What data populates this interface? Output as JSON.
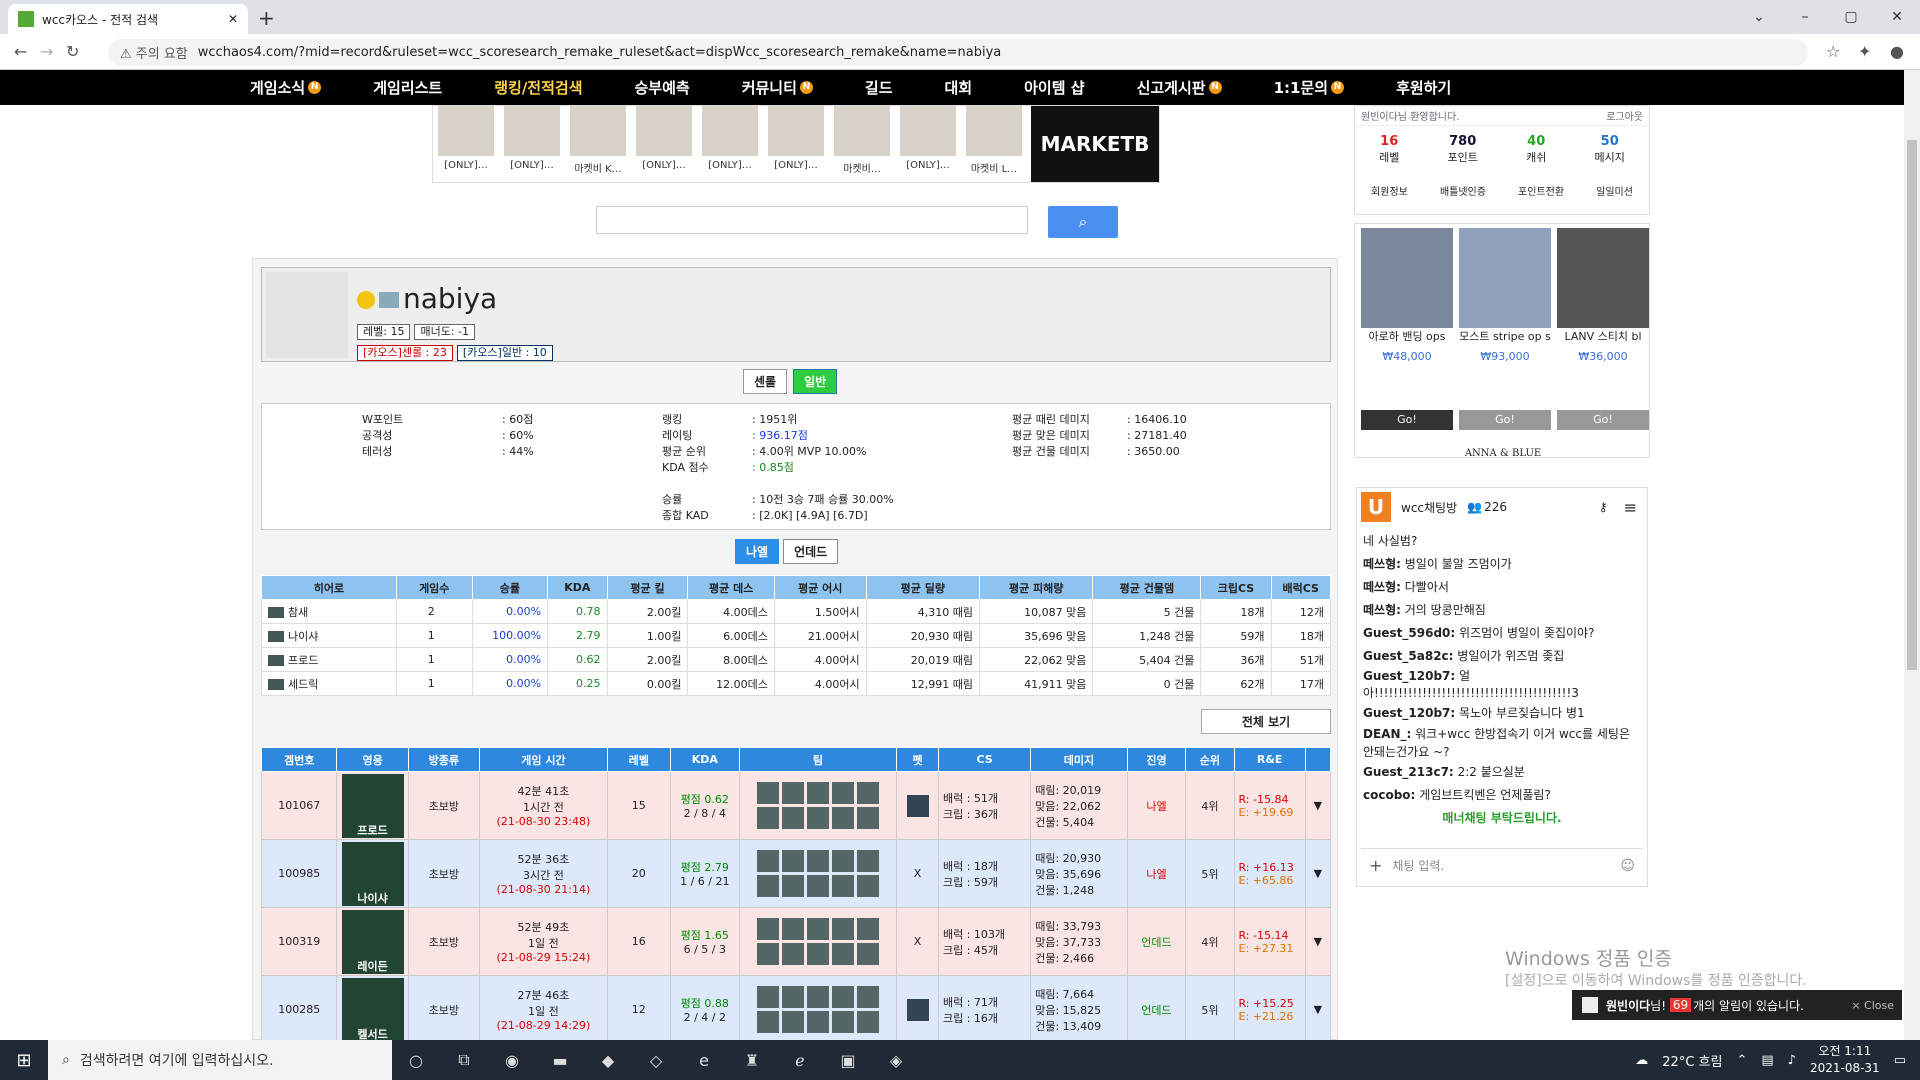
{
  "browser": {
    "tab_title": "wcc카오스 - 전적 검색",
    "url": "wcchaos4.com/?mid=record&ruleset=wcc_scoresearch_remake_ruleset&act=dispWcc_scoresearch_remake&name=nabiya",
    "security": "주의 요함"
  },
  "menu": [
    "게임소식",
    "게임리스트",
    "랭킹/전적검색",
    "승부예측",
    "커뮤니티",
    "길드",
    "대회",
    "아이템 샵",
    "신고게시판",
    "1:1문의",
    "후원하기"
  ],
  "ad": {
    "items": [
      "[ONLY]…",
      "[ONLY]…",
      "마켓비 K…",
      "[ONLY]…",
      "[ONLY]…",
      "[ONLY]…",
      "마켓비…",
      "[ONLY]…",
      "마켓비 L…"
    ],
    "brand": "MARKETB"
  },
  "profile": {
    "name": "nabiya",
    "level": "레벨: 15",
    "manner": "매너도: -1",
    "rank_tag": "[카오스]센롤 : 23",
    "normal_tag": "[카오스]일반 : 10"
  },
  "mode": {
    "b1": "센롤",
    "b2": "일반"
  },
  "stats": {
    "c1": [
      [
        "W포인트",
        ": 60점"
      ],
      [
        "공격성",
        ": 60%"
      ],
      [
        "테러성",
        ": 44%"
      ]
    ],
    "c2": [
      [
        "랭킹",
        ": 1951위"
      ],
      [
        "레이팅",
        ": 936.17점"
      ],
      [
        "평균 순위",
        ": 4.00위  MVP 10.00%"
      ],
      [
        "KDA 점수",
        ": 0.85점"
      ],
      [
        "승률",
        ": 10전 3승 7패 승률 30.00%"
      ],
      [
        "종합 KAD",
        ": [2.0K] [4.9A] [6.7D]"
      ]
    ],
    "c3": [
      [
        "평균 때린 데미지",
        ": 16406.10"
      ],
      [
        "평균 맞은 데미지",
        ": 27181.40"
      ],
      [
        "평균 건물 데미지",
        ": 3650.00"
      ]
    ]
  },
  "view": {
    "b1": "나엘",
    "b2": "언데드"
  },
  "hero_table": {
    "headers": [
      "히어로",
      "게임수",
      "승률",
      "KDA",
      "평균 킬",
      "평균 데스",
      "평균 어시",
      "평균 딜량",
      "평균 피해량",
      "평균 건물뎀",
      "크립CS",
      "배럭CS"
    ],
    "rows": [
      [
        "참새",
        "2",
        "0.00%",
        "0.78",
        "2.00킬",
        "4.00데스",
        "1.50어시",
        "4,310 때림",
        "10,087 맞음",
        "5 건물",
        "18개",
        "12개"
      ],
      [
        "나이샤",
        "1",
        "100.00%",
        "2.79",
        "1.00킬",
        "6.00데스",
        "21.00어시",
        "20,930 때림",
        "35,696 맞음",
        "1,248 건물",
        "59개",
        "18개"
      ],
      [
        "프로드",
        "1",
        "0.00%",
        "0.62",
        "2.00킬",
        "8.00데스",
        "4.00어시",
        "20,019 때림",
        "22,062 맞음",
        "5,404 건물",
        "36개",
        "51개"
      ],
      [
        "세드릭",
        "1",
        "0.00%",
        "0.25",
        "0.00킬",
        "12.00데스",
        "4.00어시",
        "12,991 때림",
        "41,911 맞음",
        "0 건물",
        "62개",
        "17개"
      ]
    ]
  },
  "all_btn": "전체 보기",
  "game_table": {
    "headers": [
      "겜번호",
      "영웅",
      "방종류",
      "게임 시간",
      "레벨",
      "KDA",
      "팀",
      "펫",
      "CS",
      "데미지",
      "진영",
      "순위",
      "R&E"
    ],
    "rows": [
      {
        "no": "101067",
        "hero": "프로드",
        "room": "초보방",
        "dur": "42분 41초",
        "ago": "1시간 전",
        "date": "(21-08-30 23:48)",
        "lv": "15",
        "kda": "평점 0.62",
        "kda2": "2 / 8 / 4",
        "pet": "",
        "cs1": "배럭 : 51개",
        "cs2": "크립 : 36개",
        "d1": "때림: 20,019",
        "d2": "맞음: 22,062",
        "d3": "건물: 5,404",
        "side": "나엘",
        "rank": "4위",
        "r": "R: -15.84",
        "e": "E: +19.69"
      },
      {
        "no": "100985",
        "hero": "나이샤",
        "room": "초보방",
        "dur": "52분 36초",
        "ago": "3시간 전",
        "date": "(21-08-30 21:14)",
        "lv": "20",
        "kda": "평점 2.79",
        "kda2": "1 / 6 / 21",
        "pet": "X",
        "cs1": "배럭 : 18개",
        "cs2": "크립 : 59개",
        "d1": "때림: 20,930",
        "d2": "맞음: 35,696",
        "d3": "건물: 1,248",
        "side": "나엘",
        "rank": "5위",
        "r": "R: +16.13",
        "e": "E: +65.86"
      },
      {
        "no": "100319",
        "hero": "레이든",
        "room": "초보방",
        "dur": "52분 49초",
        "ago": "1일 전",
        "date": "(21-08-29 15:24)",
        "lv": "16",
        "kda": "평점 1.65",
        "kda2": "6 / 5 / 3",
        "pet": "X",
        "cs1": "배럭 : 103개",
        "cs2": "크립 : 45개",
        "d1": "때림: 33,793",
        "d2": "맞음: 37,733",
        "d3": "건물: 2,466",
        "side": "언데드",
        "rank": "4위",
        "r": "R: -15.14",
        "e": "E: +27.31"
      },
      {
        "no": "100285",
        "hero": "켈서드",
        "room": "초보방",
        "dur": "27분 46초",
        "ago": "1일 전",
        "date": "(21-08-29 14:29)",
        "lv": "12",
        "kda": "평점 0.88",
        "kda2": "2 / 4 / 2",
        "pet": "",
        "cs1": "배럭 : 71개",
        "cs2": "크립 : 16개",
        "d1": "때림: 7,664",
        "d2": "맞음: 15,825",
        "d3": "건물: 13,409",
        "side": "언데드",
        "rank": "5위",
        "r": "R: +15.25",
        "e": "E: +21.26"
      }
    ]
  },
  "side": {
    "welcome": "원빈이다님 환영합니다.",
    "logout": "로그아웃",
    "info": [
      [
        "16",
        "레벨"
      ],
      [
        "780",
        "포인트"
      ],
      [
        "40",
        "캐쉬"
      ],
      [
        "50",
        "메시지"
      ]
    ],
    "links": [
      "회원정보",
      "배틀넷인증",
      "포인트전환",
      "일일미션"
    ],
    "products": [
      {
        "name": "아로하 밴딩 ops",
        "price": "₩48,000"
      },
      {
        "name": "모스트 stripe op s",
        "price": "₩93,000"
      },
      {
        "name": "LANV 스티치 bl",
        "price": "₩36,000"
      }
    ],
    "go": "Go!",
    "brand": "ANNA & BLUE"
  },
  "chat": {
    "title": "wcc채팅방",
    "count": "226",
    "messages": [
      [
        "",
        "네 사실범?"
      ],
      [
        "떼쓰형:",
        "병일이 불알 즈멈이가"
      ],
      [
        "떼쓰형:",
        "다빨아서"
      ],
      [
        "떼쓰형:",
        "거의 땅콩만해짐"
      ],
      [
        "Guest_596d0:",
        "위즈멈이 병일이 좆집이야?"
      ],
      [
        "Guest_5a82c:",
        "병일이가 위즈멈 좆집"
      ],
      [
        "Guest_120b7:",
        "얼 아!!!!!!!!!!!!!!!!!!!!!!!!!!!!!!!!!!!!!!!!!3"
      ],
      [
        "Guest_120b7:",
        "목노아 부르짖습니다 병1"
      ],
      [
        "DEAN_:",
        "워크+wcc 한방접속기 이거 wcc를 세팅은 안돼는건가요 ~?"
      ],
      [
        "Guest_213c7:",
        "2:2 붙으실분"
      ],
      [
        "cocobo:",
        "게임브트킥벤은 언제풀림?"
      ]
    ],
    "notice": "매너채팅 부탁드립니다.",
    "placeholder": "채팅 입력."
  },
  "windows": {
    "activate": "Windows 정품 인증",
    "activate2": "[설정]으로 이동하여 Windows를 정품 인증합니다."
  },
  "toast": {
    "user": "원빈이다",
    "suffix": "님!",
    "count": "69",
    "msg": "개의 알림이 있습니다.",
    "close": "× Close"
  },
  "taskbar": {
    "search": "검색하려면 여기에 입력하십시오.",
    "weather": "22°C 흐림",
    "time": "오전 1:11",
    "date": "2021-08-31"
  }
}
